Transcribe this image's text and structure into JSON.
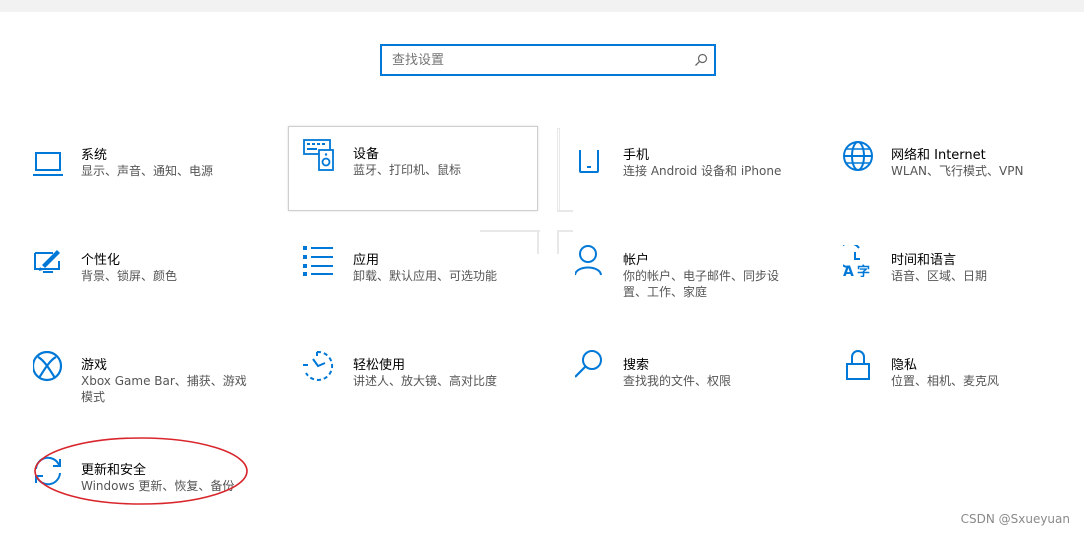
{
  "search": {
    "placeholder": "查找设置"
  },
  "tiles": [
    {
      "name": "系统",
      "desc": "显示、声音、通知、电源",
      "icon": "laptop-icon"
    },
    {
      "name": "设备",
      "desc": "蓝牙、打印机、鼠标",
      "icon": "keyboard-speaker-icon"
    },
    {
      "name": "手机",
      "desc": "连接 Android 设备和 iPhone",
      "icon": "phone-icon"
    },
    {
      "name": "网络和 Internet",
      "desc": "WLAN、飞行模式、VPN",
      "icon": "globe-icon"
    },
    {
      "name": "个性化",
      "desc": "背景、锁屏、颜色",
      "icon": "paint-brush-monitor-icon"
    },
    {
      "name": "应用",
      "desc": "卸载、默认应用、可选功能",
      "icon": "app-list-icon"
    },
    {
      "name": "帐户",
      "desc": "你的帐户、电子邮件、同步设置、工作、家庭",
      "icon": "person-icon"
    },
    {
      "name": "时间和语言",
      "desc": "语音、区域、日期",
      "icon": "clock-language-icon"
    },
    {
      "name": "游戏",
      "desc": "Xbox Game Bar、捕获、游戏模式",
      "icon": "xbox-icon"
    },
    {
      "name": "轻松使用",
      "desc": "讲述人、放大镜、高对比度",
      "icon": "ease-of-access-icon"
    },
    {
      "name": "搜索",
      "desc": "查找我的文件、权限",
      "icon": "search-icon"
    },
    {
      "name": "隐私",
      "desc": "位置、相机、麦克风",
      "icon": "lock-icon"
    },
    {
      "name": "更新和安全",
      "desc": "Windows 更新、恢复、备份",
      "icon": "sync-icon"
    }
  ],
  "watermark": "CSDN @Sxueyuan",
  "colors": {
    "accent": "#0078d7",
    "highlight_oval": "#d9262c"
  }
}
